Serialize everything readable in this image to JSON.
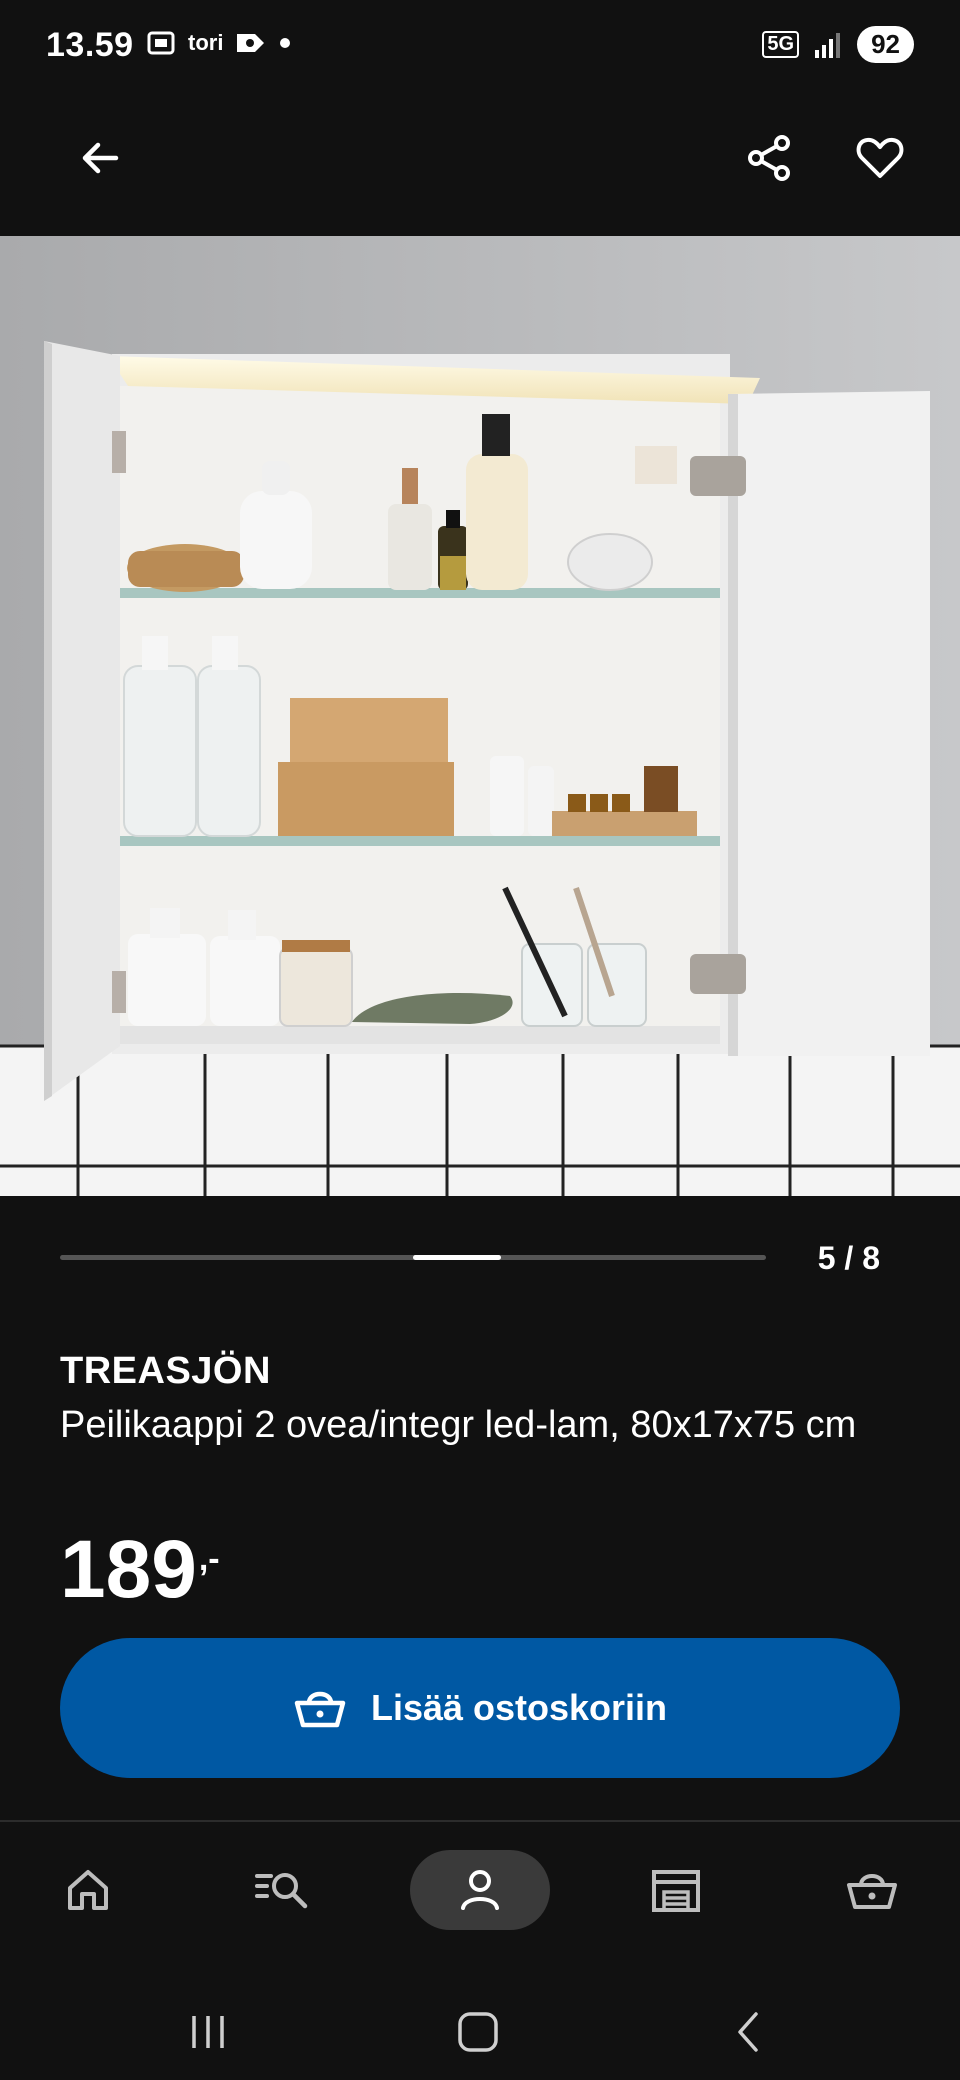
{
  "status_bar": {
    "time": "13.59",
    "app_label": "tori",
    "network": "5G",
    "battery": "92"
  },
  "app_bar": {
    "back_icon": "arrow-left-icon",
    "share_icon": "share-icon",
    "favorite_icon": "heart-outline-icon"
  },
  "gallery": {
    "image_description_icon": "product-photo",
    "counter": "5 / 8",
    "progress_fraction": 0.625
  },
  "product": {
    "brand": "TREASJÖN",
    "description": "Peilikaappi 2 ovea/integr led-lam, 80x17x75 cm",
    "price": "189",
    "price_suffix": ",-"
  },
  "cta": {
    "label": "Lisää ostoskoriin",
    "icon": "basket-icon"
  },
  "bottom_nav": {
    "items": [
      {
        "icon": "home-icon",
        "active": false
      },
      {
        "icon": "search-list-icon",
        "active": false
      },
      {
        "icon": "profile-icon",
        "active": true
      },
      {
        "icon": "store-icon",
        "active": false
      },
      {
        "icon": "basket-icon",
        "active": false
      }
    ]
  },
  "colors": {
    "background": "#111111",
    "accent": "#0058a3",
    "text": "#ffffff"
  }
}
